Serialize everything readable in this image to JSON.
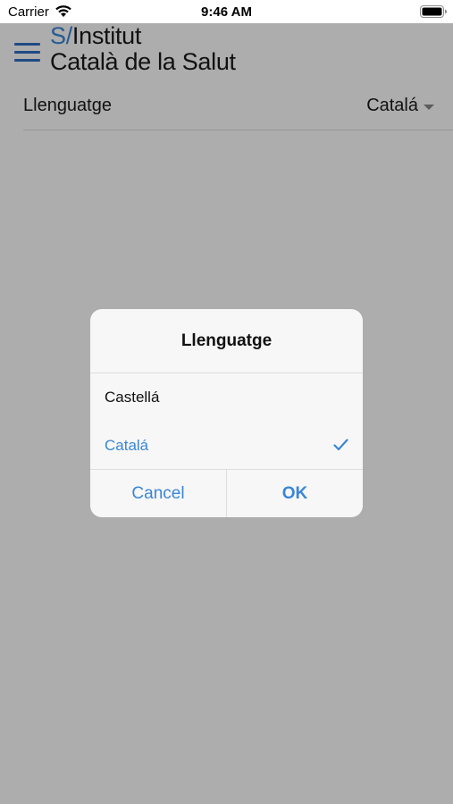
{
  "status_bar": {
    "carrier": "Carrier",
    "time": "9:46 AM",
    "wifi_icon": "wifi-icon",
    "battery_icon": "battery-icon"
  },
  "header": {
    "logo_prefix": "S/",
    "logo_line1": "Institut",
    "logo_line2": "Català de la Salut",
    "menu_icon": "hamburger-menu-icon"
  },
  "settings": {
    "language_label": "Llenguatge",
    "language_value": "Catalá"
  },
  "dialog": {
    "title": "Llenguatge",
    "options": [
      {
        "label": "Castellá",
        "selected": false
      },
      {
        "label": "Catalá",
        "selected": true
      }
    ],
    "cancel_label": "Cancel",
    "ok_label": "OK"
  },
  "colors": {
    "accent": "#3a86d6",
    "overlay": "rgba(0,0,0,0.32)",
    "dialog_bg": "#f7f7f7"
  }
}
